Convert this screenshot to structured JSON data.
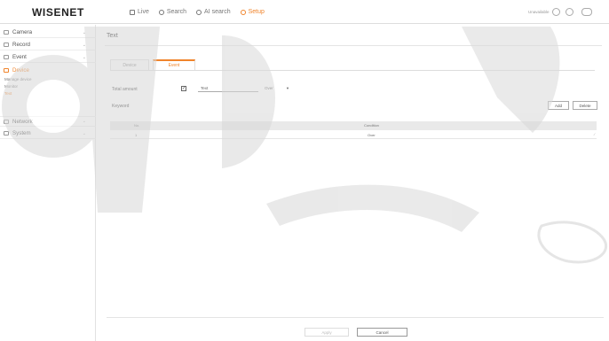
{
  "app": {
    "logo": "WISENET",
    "user": "Unavailable"
  },
  "nav": [
    {
      "label": "Live",
      "icon": "monitor-icon",
      "active": false
    },
    {
      "label": "Search",
      "icon": "search-icon",
      "active": false
    },
    {
      "label": "AI search",
      "icon": "ai-search-icon",
      "active": false
    },
    {
      "label": "Setup",
      "icon": "gear-icon",
      "active": true
    }
  ],
  "sidebar": {
    "items": [
      {
        "label": "Camera",
        "icon": "camera-icon"
      },
      {
        "label": "Record",
        "icon": "record-icon"
      },
      {
        "label": "Event",
        "icon": "event-icon"
      },
      {
        "label": "Device",
        "icon": "device-icon"
      },
      {
        "label": "Network",
        "icon": "network-icon"
      },
      {
        "label": "System",
        "icon": "system-icon"
      }
    ],
    "device_sub": [
      {
        "label": "Manage device"
      },
      {
        "label": "Monitor"
      },
      {
        "label": "Text"
      }
    ]
  },
  "main": {
    "title": "Text",
    "tabs": [
      {
        "label": "Device"
      },
      {
        "label": "Event"
      }
    ],
    "total_amount_label": "Total amount",
    "checkbox_mark": "✓",
    "text_field_value": "Text",
    "select_value": "Over",
    "keyword_label": "Keyword",
    "add_label": "Add",
    "delete_label": "Delete",
    "table": {
      "headers": [
        "No.",
        "Condition"
      ],
      "rows": [
        [
          "1",
          "Over"
        ]
      ]
    },
    "apply_label": "Apply",
    "cancel_label": "Cancel"
  },
  "colors": {
    "accent": "#f0842b",
    "watermark": "#cfcfcf"
  }
}
